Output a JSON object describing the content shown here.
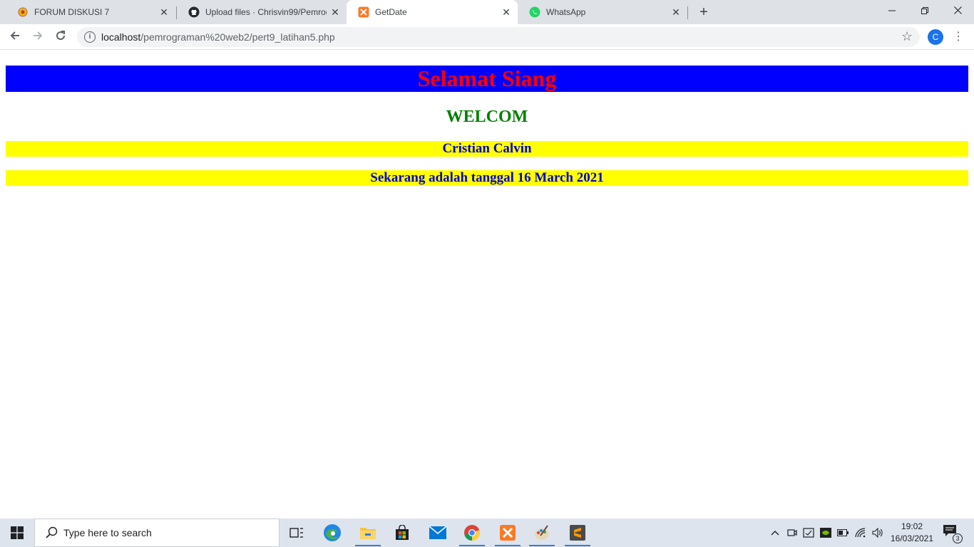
{
  "browser": {
    "tabs": [
      {
        "title": "FORUM DISKUSI 7",
        "icon": "moodle-icon",
        "active": false
      },
      {
        "title": "Upload files · Chrisvin99/Pemrog",
        "icon": "github-icon",
        "active": false
      },
      {
        "title": "GetDate",
        "icon": "xampp-icon",
        "active": true
      },
      {
        "title": "WhatsApp",
        "icon": "whatsapp-icon",
        "active": false
      }
    ],
    "close_glyph": "✕",
    "new_tab_glyph": "+",
    "address": {
      "host": "localhost",
      "path": "/pemrograman%20web2/pert9_latihan5.php"
    },
    "profile_initial": "C"
  },
  "page": {
    "greeting": "Selamat Siang",
    "welcome": "WELCOM",
    "name": "Cristian Calvin",
    "date_line": "Sekarang adalah tanggal 16 March 2021"
  },
  "taskbar": {
    "search_placeholder": "Type here to search",
    "pinned": [
      "task-view-icon",
      "edge-icon",
      "file-explorer-icon",
      "store-icon",
      "mail-icon",
      "chrome-icon",
      "xampp-icon",
      "paint-icon",
      "sublime-text-icon"
    ],
    "clock_time": "19:02",
    "clock_date": "16/03/2021",
    "notification_count": "3"
  },
  "colors": {
    "greeting_bg": "#0000ff",
    "greeting_text": "#ff0000",
    "welcome_text": "#008000",
    "bar_bg": "#ffff00",
    "bar_text": "#0000cc"
  }
}
